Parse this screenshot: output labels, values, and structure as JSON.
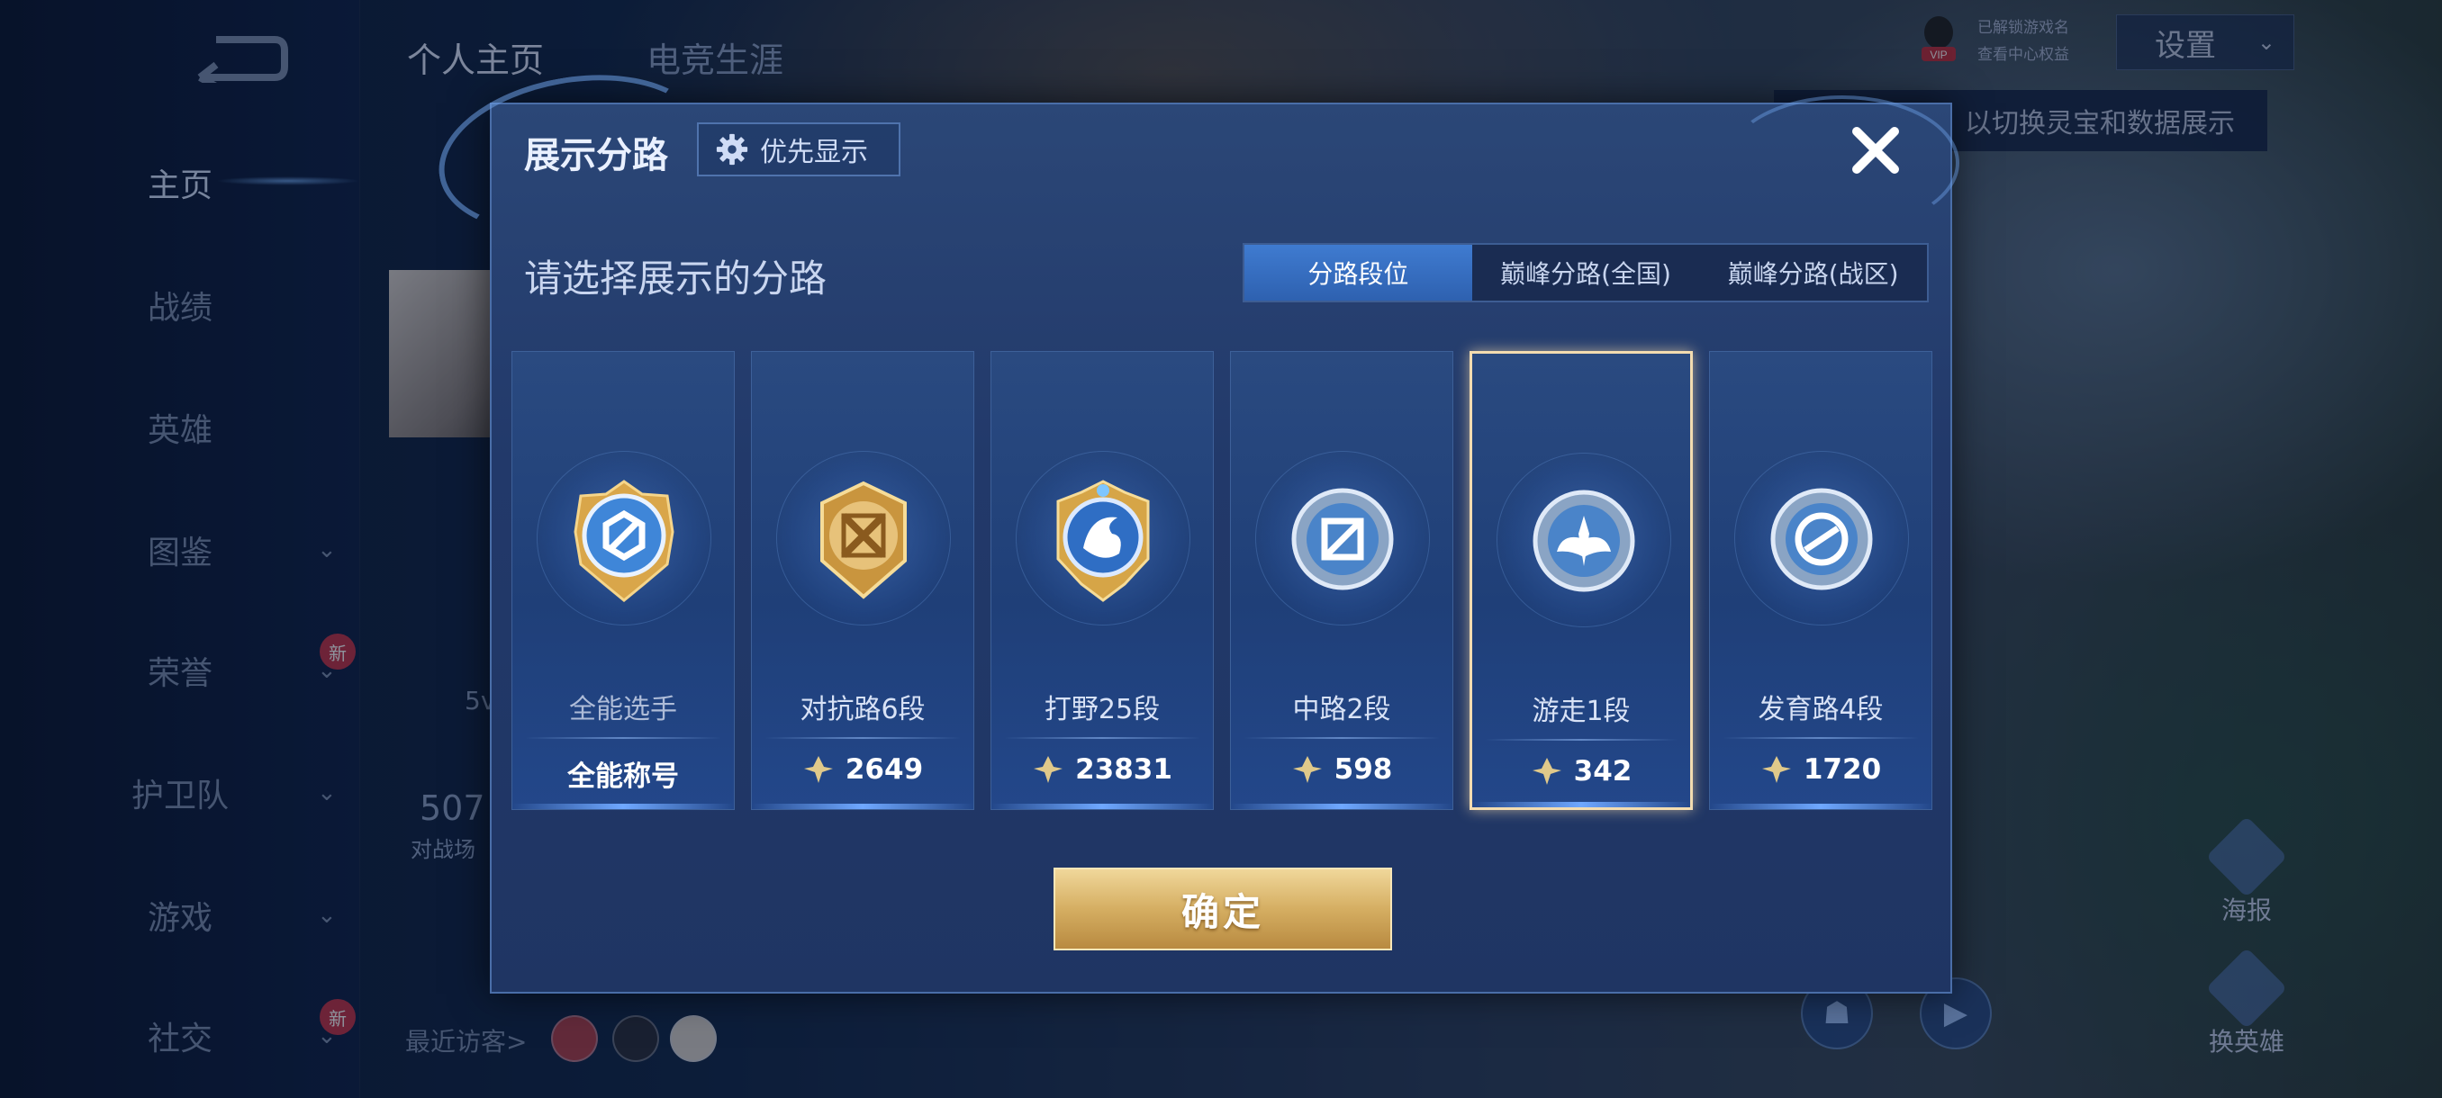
{
  "colors": {
    "accent_blue": "#2e61b0",
    "gold": "#d5ae62",
    "selected_border": "#f3dcb0",
    "point_icon": "#e0c98a"
  },
  "sidebar": {
    "back_icon": "back-arrow-icon",
    "items": [
      {
        "label": "主页",
        "active": true
      },
      {
        "label": "战绩"
      },
      {
        "label": "英雄"
      },
      {
        "label": "图鉴",
        "chevron": true
      },
      {
        "label": "荣誉",
        "chevron": true,
        "badge": "新"
      },
      {
        "label": "护卫队",
        "chevron": true
      },
      {
        "label": "游戏",
        "chevron": true
      },
      {
        "label": "社交",
        "chevron": true,
        "badge": "新"
      }
    ]
  },
  "profile": {
    "tabs": [
      "个人主页",
      "电竞生涯"
    ],
    "partial_value": "507",
    "partial_caption": "对战场",
    "partial_stat": "5v",
    "recent_visitors_label": "最近访客>"
  },
  "right_panel": {
    "vip_label": "VIP",
    "vip_line1": "已解锁游戏名",
    "vip_line2": "查看中心权益",
    "settings_label": "设置",
    "tooltip_text": "以切换灵宝和数据展示",
    "poster_label": "海报",
    "change_hero_label": "换英雄",
    "new_badge": "新"
  },
  "modal": {
    "title": "展示分路",
    "priority_button": "优先显示",
    "section_title": "请选择展示的分路",
    "tabs": [
      {
        "label": "分路段位",
        "active": true
      },
      {
        "label": "巅峰分路(全国)"
      },
      {
        "label": "巅峰分路(战区)"
      }
    ],
    "cards": [
      {
        "label": "全能选手",
        "value": "全能称号",
        "badge": "all-round-badge-icon",
        "has_points_icon": false,
        "selected": false
      },
      {
        "label": "对抗路6段",
        "value": "2649",
        "badge": "clash-lane-badge-icon",
        "has_points_icon": true,
        "selected": false
      },
      {
        "label": "打野25段",
        "value": "23831",
        "badge": "jungle-badge-icon",
        "has_points_icon": true,
        "selected": false
      },
      {
        "label": "中路2段",
        "value": "598",
        "badge": "mid-lane-badge-icon",
        "has_points_icon": true,
        "selected": false
      },
      {
        "label": "游走1段",
        "value": "342",
        "badge": "roam-badge-icon",
        "has_points_icon": true,
        "selected": true
      },
      {
        "label": "发育路4段",
        "value": "1720",
        "badge": "farm-lane-badge-icon",
        "has_points_icon": true,
        "selected": false
      }
    ],
    "confirm_button": "确定"
  }
}
